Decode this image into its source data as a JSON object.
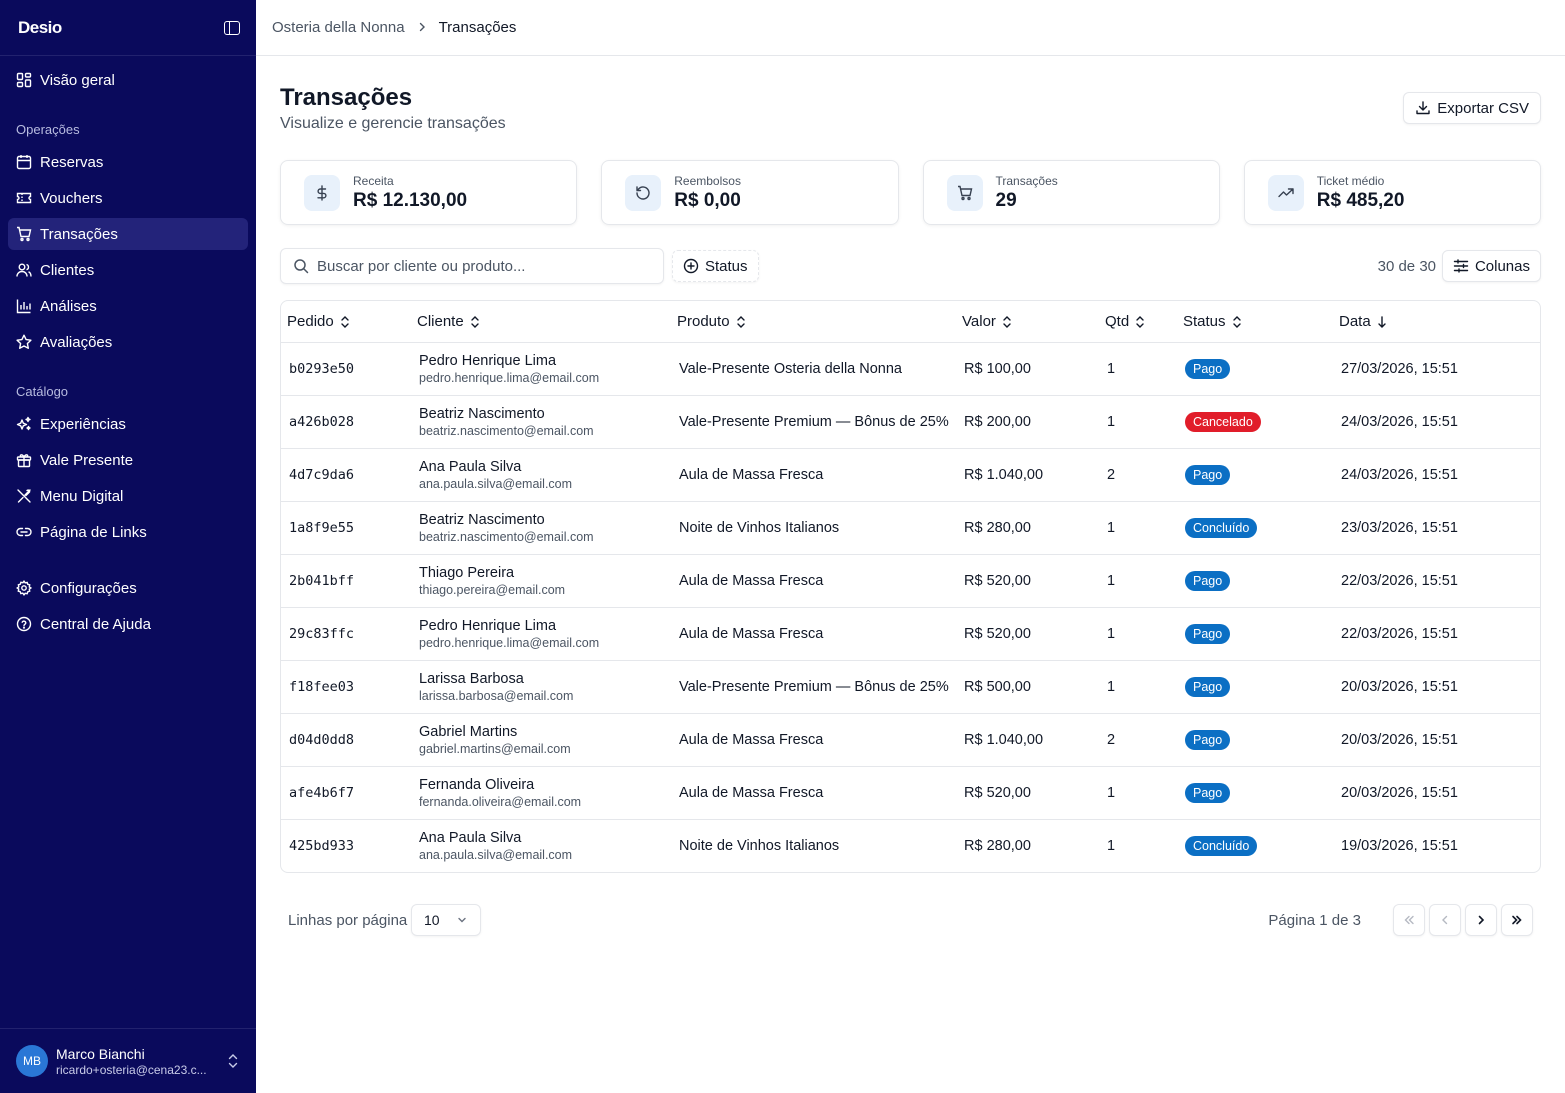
{
  "brand": {
    "logo": "Desio"
  },
  "breadcrumb": {
    "parent": "Osteria della Nonna",
    "current": "Transações"
  },
  "sidebar": {
    "overview": "Visão geral",
    "sections": {
      "operacoes": "Operações",
      "catalogo": "Catálogo"
    },
    "operacoes": [
      "Reservas",
      "Vouchers",
      "Transações",
      "Clientes",
      "Análises",
      "Avaliações"
    ],
    "catalogo": [
      "Experiências",
      "Vale Presente",
      "Menu Digital",
      "Página de Links"
    ],
    "bottom": [
      "Configurações",
      "Central de Ajuda"
    ],
    "active": "Transações"
  },
  "user": {
    "initials": "MB",
    "name": "Marco Bianchi",
    "email": "ricardo+osteria@cena23.c..."
  },
  "page": {
    "title": "Transações",
    "subtitle": "Visualize e gerencie transações",
    "export_label": "Exportar CSV"
  },
  "stats": [
    {
      "label": "Receita",
      "value": "R$ 12.130,00",
      "icon": "dollar-icon"
    },
    {
      "label": "Reembolsos",
      "value": "R$ 0,00",
      "icon": "refund-icon"
    },
    {
      "label": "Transações",
      "value": "29",
      "icon": "cart-icon"
    },
    {
      "label": "Ticket médio",
      "value": "R$ 485,20",
      "icon": "trending-up-icon"
    }
  ],
  "toolbar": {
    "search_placeholder": "Buscar por cliente ou produto...",
    "status_filter": "Status",
    "count": "30 de 30",
    "columns_label": "Colunas"
  },
  "table": {
    "headers": [
      "Pedido",
      "Cliente",
      "Produto",
      "Valor",
      "Qtd",
      "Status",
      "Data"
    ],
    "rows": [
      {
        "order": "b0293e50",
        "client": "Pedro Henrique Lima",
        "email": "pedro.henrique.lima@email.com",
        "product": "Vale-Presente Osteria della Nonna",
        "value": "R$ 100,00",
        "qty": "1",
        "status": "Pago",
        "date": "27/03/2026, 15:51"
      },
      {
        "order": "a426b028",
        "client": "Beatriz Nascimento",
        "email": "beatriz.nascimento@email.com",
        "product": "Vale-Presente Premium — Bônus de 25%",
        "value": "R$ 200,00",
        "qty": "1",
        "status": "Cancelado",
        "date": "24/03/2026, 15:51"
      },
      {
        "order": "4d7c9da6",
        "client": "Ana Paula Silva",
        "email": "ana.paula.silva@email.com",
        "product": "Aula de Massa Fresca",
        "value": "R$ 1.040,00",
        "qty": "2",
        "status": "Pago",
        "date": "24/03/2026, 15:51"
      },
      {
        "order": "1a8f9e55",
        "client": "Beatriz Nascimento",
        "email": "beatriz.nascimento@email.com",
        "product": "Noite de Vinhos Italianos",
        "value": "R$ 280,00",
        "qty": "1",
        "status": "Concluído",
        "date": "23/03/2026, 15:51"
      },
      {
        "order": "2b041bff",
        "client": "Thiago Pereira",
        "email": "thiago.pereira@email.com",
        "product": "Aula de Massa Fresca",
        "value": "R$ 520,00",
        "qty": "1",
        "status": "Pago",
        "date": "22/03/2026, 15:51"
      },
      {
        "order": "29c83ffc",
        "client": "Pedro Henrique Lima",
        "email": "pedro.henrique.lima@email.com",
        "product": "Aula de Massa Fresca",
        "value": "R$ 520,00",
        "qty": "1",
        "status": "Pago",
        "date": "22/03/2026, 15:51"
      },
      {
        "order": "f18fee03",
        "client": "Larissa Barbosa",
        "email": "larissa.barbosa@email.com",
        "product": "Vale-Presente Premium — Bônus de 25%",
        "value": "R$ 500,00",
        "qty": "1",
        "status": "Pago",
        "date": "20/03/2026, 15:51"
      },
      {
        "order": "d04d0dd8",
        "client": "Gabriel Martins",
        "email": "gabriel.martins@email.com",
        "product": "Aula de Massa Fresca",
        "value": "R$ 1.040,00",
        "qty": "2",
        "status": "Pago",
        "date": "20/03/2026, 15:51"
      },
      {
        "order": "afe4b6f7",
        "client": "Fernanda Oliveira",
        "email": "fernanda.oliveira@email.com",
        "product": "Aula de Massa Fresca",
        "value": "R$ 520,00",
        "qty": "1",
        "status": "Pago",
        "date": "20/03/2026, 15:51"
      },
      {
        "order": "425bd933",
        "client": "Ana Paula Silva",
        "email": "ana.paula.silva@email.com",
        "product": "Noite de Vinhos Italianos",
        "value": "R$ 280,00",
        "qty": "1",
        "status": "Concluído",
        "date": "19/03/2026, 15:51"
      }
    ]
  },
  "status_colors": {
    "Pago": "#0b6fc4",
    "Cancelado": "#e11d2a",
    "Concluído": "#0b6fc4"
  },
  "pagination": {
    "rows_label": "Linhas por página",
    "rows_value": "10",
    "page_label": "Página 1 de 3"
  },
  "colors": {
    "sidebar_bg": "#0a0a5c",
    "sidebar_active": "#23237a",
    "accent": "#0b6fc4",
    "danger": "#e11d2a"
  }
}
